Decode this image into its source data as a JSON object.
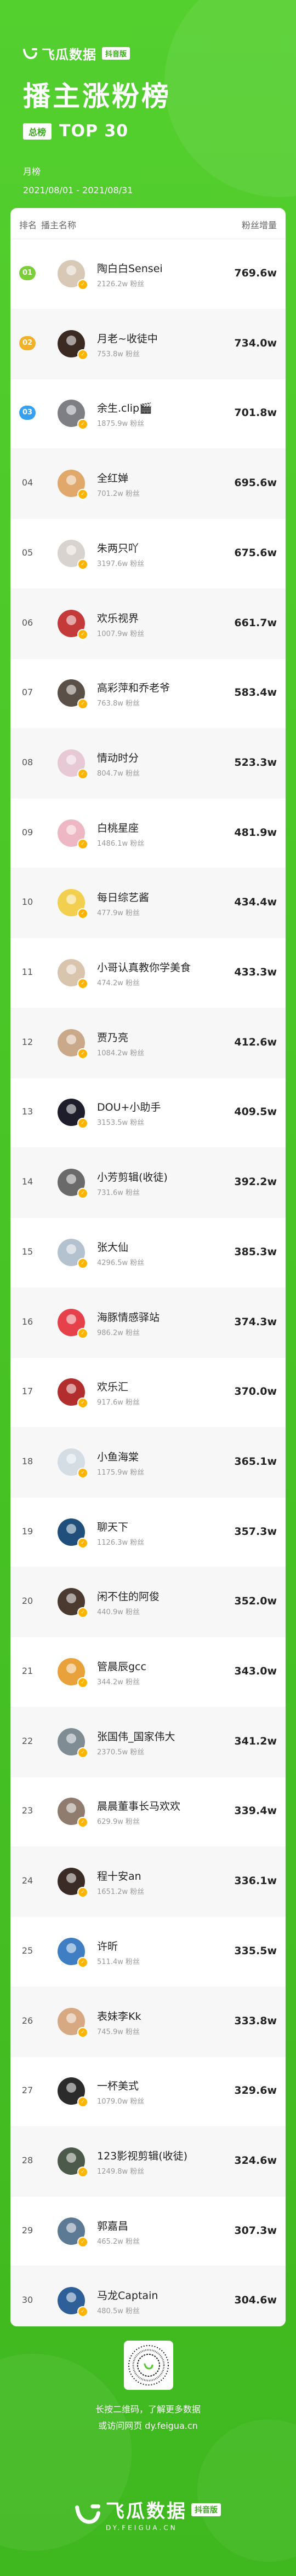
{
  "brand": {
    "name": "飞瓜数据",
    "badge": "抖音版"
  },
  "title": "播主涨粉榜",
  "tag": "总榜",
  "subtitle": "TOP 30",
  "period": "月榜",
  "date_range": "2021/08/01 - 2021/08/31",
  "table": {
    "headers": {
      "rank": "排名",
      "name": "播主名称",
      "gain": "粉丝增量"
    },
    "rows": [
      {
        "rank": "01",
        "name": "陶白白Sensei",
        "fans": "2126.2w 粉丝",
        "gain": "769.6w",
        "color": "#d8c9b6"
      },
      {
        "rank": "02",
        "name": "月老~收徒中",
        "fans": "753.8w 粉丝",
        "gain": "734.0w",
        "color": "#3a2a22"
      },
      {
        "rank": "03",
        "name": "余生.clip🎬",
        "fans": "1875.9w 粉丝",
        "gain": "701.8w",
        "color": "#7d7f84"
      },
      {
        "rank": "04",
        "name": "全红婵",
        "fans": "701.2w 粉丝",
        "gain": "695.6w",
        "color": "#e0a86a"
      },
      {
        "rank": "05",
        "name": "朱两只吖",
        "fans": "3197.6w 粉丝",
        "gain": "675.6w",
        "color": "#d9d3cf"
      },
      {
        "rank": "06",
        "name": "欢乐视界",
        "fans": "1007.9w 粉丝",
        "gain": "661.7w",
        "color": "#c43a3a"
      },
      {
        "rank": "07",
        "name": "高彩萍和乔老爷",
        "fans": "763.8w 粉丝",
        "gain": "583.4w",
        "color": "#5b5048"
      },
      {
        "rank": "08",
        "name": "情动时分",
        "fans": "804.7w 粉丝",
        "gain": "523.3w",
        "color": "#e7c8d5"
      },
      {
        "rank": "09",
        "name": "白桃星座",
        "fans": "1486.1w 粉丝",
        "gain": "481.9w",
        "color": "#edb8c3"
      },
      {
        "rank": "10",
        "name": "每日综艺酱",
        "fans": "477.9w 粉丝",
        "gain": "434.4w",
        "color": "#f3cf4f"
      },
      {
        "rank": "11",
        "name": "小哥认真教你学美食",
        "fans": "474.2w 粉丝",
        "gain": "433.3w",
        "color": "#d9c4ad"
      },
      {
        "rank": "12",
        "name": "贾乃亮",
        "fans": "1084.2w 粉丝",
        "gain": "412.6w",
        "color": "#c9a98a"
      },
      {
        "rank": "13",
        "name": "DOU+小助手",
        "fans": "3153.5w 粉丝",
        "gain": "409.5w",
        "color": "#1d1d2b"
      },
      {
        "rank": "14",
        "name": "小芳剪辑(收徒)",
        "fans": "731.6w 粉丝",
        "gain": "392.2w",
        "color": "#6a6a6a"
      },
      {
        "rank": "15",
        "name": "张大仙",
        "fans": "4296.5w 粉丝",
        "gain": "385.3w",
        "color": "#b4c1cf"
      },
      {
        "rank": "16",
        "name": "海豚情感驿站",
        "fans": "986.2w 粉丝",
        "gain": "374.3w",
        "color": "#e6404a"
      },
      {
        "rank": "17",
        "name": "欢乐汇",
        "fans": "917.6w 粉丝",
        "gain": "370.0w",
        "color": "#b22e2e"
      },
      {
        "rank": "18",
        "name": "小鱼海棠",
        "fans": "1175.9w 粉丝",
        "gain": "365.1w",
        "color": "#d4dde4"
      },
      {
        "rank": "19",
        "name": "聊天下",
        "fans": "1126.3w 粉丝",
        "gain": "357.3w",
        "color": "#1f4f7a"
      },
      {
        "rank": "20",
        "name": "闲不住的阿俊",
        "fans": "440.9w 粉丝",
        "gain": "352.0w",
        "color": "#4a3a30"
      },
      {
        "rank": "21",
        "name": "管晨辰gcc",
        "fans": "344.2w 粉丝",
        "gain": "343.0w",
        "color": "#e9a23b"
      },
      {
        "rank": "22",
        "name": "张国伟_国家伟大",
        "fans": "2370.5w 粉丝",
        "gain": "341.2w",
        "color": "#7f8c94"
      },
      {
        "rank": "23",
        "name": "晨晨董事长马欢欢",
        "fans": "629.9w 粉丝",
        "gain": "339.4w",
        "color": "#8f7c6f"
      },
      {
        "rank": "24",
        "name": "程十安an",
        "fans": "1651.2w 粉丝",
        "gain": "336.1w",
        "color": "#3a2b26"
      },
      {
        "rank": "25",
        "name": "许昕",
        "fans": "511.4w 粉丝",
        "gain": "335.5w",
        "color": "#3f7ec2"
      },
      {
        "rank": "26",
        "name": "表妹李Kk",
        "fans": "745.9w 粉丝",
        "gain": "333.8w",
        "color": "#d7a983"
      },
      {
        "rank": "27",
        "name": "一杯美式",
        "fans": "1079.0w 粉丝",
        "gain": "329.6w",
        "color": "#2b2b2b"
      },
      {
        "rank": "28",
        "name": "123影视剪辑(收徒)",
        "fans": "1249.8w 粉丝",
        "gain": "324.6w",
        "color": "#4b5a4a"
      },
      {
        "rank": "29",
        "name": "郭嘉昌",
        "fans": "465.2w 粉丝",
        "gain": "307.3w",
        "color": "#5d7a95"
      },
      {
        "rank": "30",
        "name": "马龙Captain",
        "fans": "480.5w 粉丝",
        "gain": "304.6w",
        "color": "#2f5f99"
      }
    ]
  },
  "footer": {
    "scan_text": "长按二维码，了解更多数据",
    "visit_text": "或访问网页 dy.feigua.cn",
    "brand_name": "飞瓜数据",
    "brand_badge": "抖音版",
    "brand_url": "DY.FEIGUA.CN"
  },
  "colors": {
    "accent": "#4fcb2c",
    "rank1": "#7ccd3a",
    "rank2": "#f2b12b",
    "rank3": "#37a0f0"
  }
}
